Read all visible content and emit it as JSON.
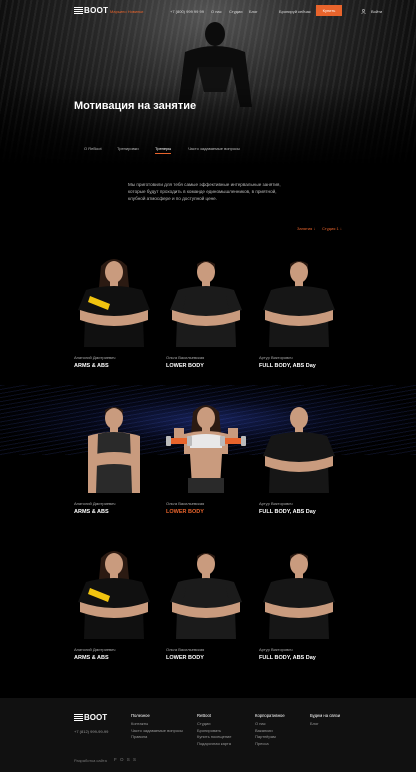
{
  "header": {
    "logo": "BOOT",
    "city": "Марьино Новинки",
    "phone": "+7 (800) 999 99 99",
    "nav": [
      "О нас",
      "Студии",
      "Блог"
    ],
    "book": "Бронируй сейчас",
    "buy": "Купить",
    "login": "Войти"
  },
  "hero": {
    "title": "Мотивация на занятие"
  },
  "tabs": [
    {
      "label": "О ReBoot",
      "active": false
    },
    {
      "label": "Тренировки",
      "active": false
    },
    {
      "label": "Тренеры",
      "active": true
    },
    {
      "label": "Часто задаваемые вопросы",
      "active": false
    }
  ],
  "intro": "Мы приготовили для тебя самые эффективные интервальные занятия, которые будут проходить в команде единомышленников, в приятной, клубной атмосфере и по доступной цене.",
  "filters": {
    "all": "Занятия ↓",
    "studio": "Студия 1 ↓"
  },
  "trainers": [
    {
      "name": "Анатолий Дмитриевич",
      "class": "ARMS & ABS",
      "accent": false,
      "figure": "female",
      "shirt": "#101010"
    },
    {
      "name": "Ольга Васильевская",
      "class": "LOWER BODY",
      "accent": false,
      "figure": "male",
      "shirt": "#1b1b1b"
    },
    {
      "name": "Артур Викторович",
      "class": "FULL BODY, ABS Day",
      "accent": false,
      "figure": "male",
      "shirt": "#161616"
    },
    {
      "name": "Анатолий Дмитриевич",
      "class": "ARMS & ABS",
      "accent": false,
      "figure": "male-tank",
      "shirt": "#2a2a2a"
    },
    {
      "name": "Ольга Васильевская",
      "class": "LOWER BODY",
      "accent": true,
      "figure": "female-dumbbell",
      "shirt": "#c8c8c8"
    },
    {
      "name": "Артур Викторович",
      "class": "FULL BODY, ABS Day",
      "accent": false,
      "figure": "male-bald",
      "shirt": "#161616"
    },
    {
      "name": "Анатолий Дмитриевич",
      "class": "ARMS & ABS",
      "accent": false,
      "figure": "female",
      "shirt": "#101010"
    },
    {
      "name": "Ольга Васильевская",
      "class": "LOWER BODY",
      "accent": false,
      "figure": "male",
      "shirt": "#1b1b1b"
    },
    {
      "name": "Артур Викторович",
      "class": "FULL BODY, ABS Day",
      "accent": false,
      "figure": "male",
      "shirt": "#161616"
    }
  ],
  "footer": {
    "logo": "BOOT",
    "phone": "+7 (812) 999-99-99",
    "columns": [
      {
        "title": "Полезное",
        "items": [
          "Контакты",
          "Часто задаваемые вопросы",
          "Правила"
        ]
      },
      {
        "title": "ReBoot",
        "items": [
          "Студии",
          "Бронировать",
          "Купить посещение",
          "Подарочная карта"
        ]
      },
      {
        "title": "Корпоративное",
        "items": [
          "О нас",
          "Вакансии",
          "Партнёрам",
          "Пресса"
        ]
      },
      {
        "title": "Будем на связи",
        "items": [
          "Блог"
        ]
      }
    ],
    "developer": "Разработка сайта",
    "developer_logo": "F O S S"
  },
  "colors": {
    "accent": "#e8642c",
    "background": "#000000",
    "footer": "#111111"
  }
}
